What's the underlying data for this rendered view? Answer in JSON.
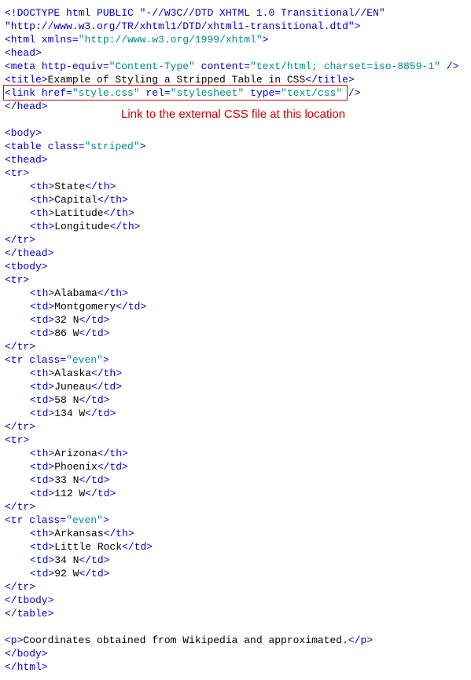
{
  "code": {
    "doctype_1": "<!DOCTYPE html PUBLIC \"-//W3C//DTD XHTML 1.0 Transitional//EN\"",
    "doctype_2": "\"http://www.w3.org/TR/xhtml1/DTD/xhtml1-transitional.dtd\">",
    "html_open_tag": "<html ",
    "html_open_attr": "xmlns",
    "html_open_eq": "=",
    "html_open_val": "\"http://www.w3.org/1999/xhtml\"",
    "html_open_close": ">",
    "head_open": "<head>",
    "meta_open": "<meta ",
    "meta_attr1": "http-equiv",
    "meta_val1": "\"Content-Type\"",
    "meta_attr2": "content",
    "meta_val2": "\"text/html; charset=iso-8859-1\"",
    "meta_close": " />",
    "title_open": "<title>",
    "title_text": "Example of Styling a Stripped Table in CSS",
    "title_close": "</title>",
    "link_open": "<link ",
    "link_attr1": "href",
    "link_val1": "\"style.css\"",
    "link_attr2": "rel",
    "link_val2": "\"stylesheet\"",
    "link_attr3": "type",
    "link_val3": "\"text/css\"",
    "link_close": " />",
    "head_close": "</head>",
    "body_open": "<body>",
    "table_open": "<table ",
    "table_attr": "class",
    "table_val": "\"striped\"",
    "table_open_close": ">",
    "thead_open": "<thead>",
    "tr_open": "<tr>",
    "th_open": "<th>",
    "th_close": "</th>",
    "td_open": "<td>",
    "td_close": "</td>",
    "tr_close": "</tr>",
    "tr_even_open": "<tr ",
    "tr_even_attr": "class",
    "tr_even_val": "\"even\"",
    "tr_even_close": ">",
    "thead_close": "</thead>",
    "tbody_open": "<tbody>",
    "tbody_close": "</tbody>",
    "table_close": "</table>",
    "p_open": "<p>",
    "p_text": "Coordinates obtained from Wikipedia and approximated.",
    "p_close": "</p>",
    "body_close": "</body>",
    "html_close": "</html>",
    "headers": {
      "h1": "State",
      "h2": "Capital",
      "h3": "Latitude",
      "h4": "Longitude"
    },
    "rows": [
      {
        "state": "Alabama",
        "capital": "Montgomery",
        "lat": "32 N",
        "lon": "86 W"
      },
      {
        "state": "Alaska",
        "capital": "Juneau",
        "lat": "58 N",
        "lon": "134 W"
      },
      {
        "state": "Arizona",
        "capital": "Phoenix",
        "lat": "33 N",
        "lon": "112 W"
      },
      {
        "state": "Arkansas",
        "capital": "Little Rock",
        "lat": "34 N",
        "lon": "92 W"
      }
    ]
  },
  "annotation": {
    "callout": "Link to the external CSS file at this location"
  }
}
